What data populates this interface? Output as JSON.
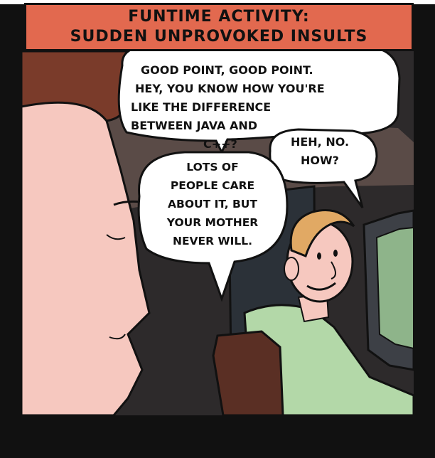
{
  "caption": {
    "line1": "FUNTIME ACTIVITY:",
    "line2": "SUDDEN UNPROVOKED INSULTS"
  },
  "bubbles": {
    "woman": {
      "line1": "GOOD POINT, GOOD POINT.",
      "line2": "HEY, YOU KNOW HOW YOU'RE",
      "line3": "LIKE THE DIFFERENCE",
      "line4": "BETWEEN JAVA AND",
      "line5": "C++?"
    },
    "man": {
      "line1": "HEH, NO.",
      "line2": "HOW?"
    },
    "punchline": {
      "line1": "LOTS OF",
      "line2": "PEOPLE CARE",
      "line3": "ABOUT IT, BUT",
      "line4": "YOUR MOTHER",
      "line5": "NEVER WILL."
    }
  },
  "colors": {
    "caption_bg": "#e2694f",
    "wall_dark": "#2d2a2b",
    "wall_brown": "#5a4b47",
    "skin": "#f6c8bf",
    "hair_woman": "#7a3b2a",
    "hair_man": "#e1a964",
    "shirt": "#b3d8a8",
    "chair": "#5a2f24",
    "monitor": "#3d4046",
    "screen": "#8eb48a"
  }
}
